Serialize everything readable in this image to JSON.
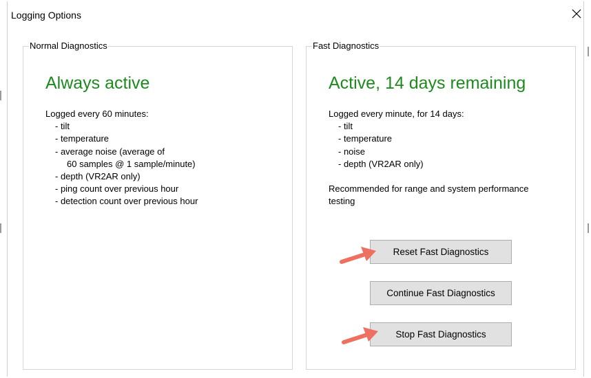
{
  "window": {
    "title": "Logging Options",
    "close_icon": "close-icon"
  },
  "normal": {
    "group_label": "Normal Diagnostics",
    "status": "Always active",
    "status_color": "#1e8a1e",
    "lines": [
      "Logged every 60 minutes:",
      "- tilt",
      "- temperature",
      "- average noise (average of",
      "60 samples @ 1 sample/minute)",
      "- depth (VR2AR only)",
      "- ping count over previous hour",
      "- detection count over previous hour"
    ]
  },
  "fast": {
    "group_label": "Fast Diagnostics",
    "status": "Active, 14 days remaining",
    "status_color": "#1e8a1e",
    "lines": [
      "Logged every minute, for 14 days:",
      "- tilt",
      "- temperature",
      "- noise",
      "- depth (VR2AR only)"
    ],
    "recommendation": [
      "Recommended for range and system performance",
      "testing"
    ],
    "buttons": {
      "reset": "Reset Fast Diagnostics",
      "continue": "Continue Fast Diagnostics",
      "stop": "Stop Fast Diagnostics"
    }
  },
  "annotations": {
    "arrow_color": "#ee7060"
  }
}
